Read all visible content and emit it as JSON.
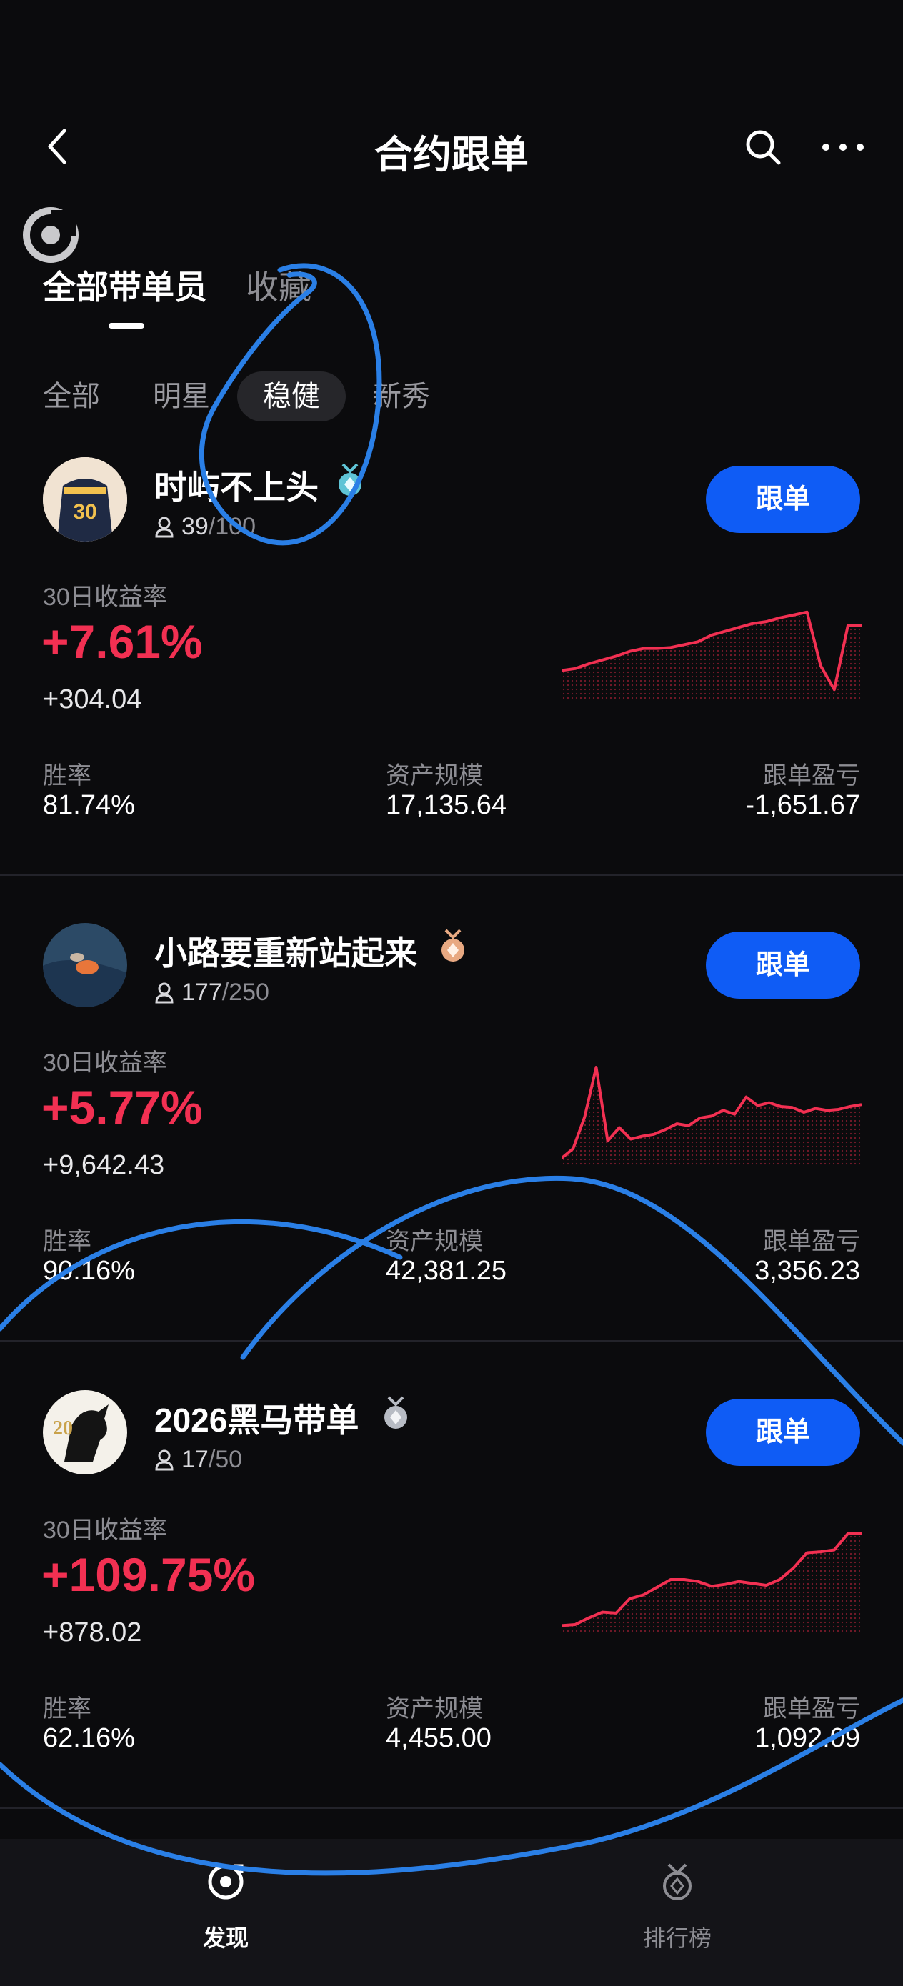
{
  "header": {
    "title": "合约跟单"
  },
  "tabs": [
    {
      "label": "全部带单员"
    },
    {
      "label": "收藏"
    }
  ],
  "filters": [
    {
      "label": "全部"
    },
    {
      "label": "明星"
    },
    {
      "label": "稳健"
    },
    {
      "label": "新秀"
    }
  ],
  "traders": [
    {
      "name": "时屿不上头",
      "followers": "39",
      "followers_total": "/100",
      "follow_label": "跟单",
      "return_label": "30日收益率",
      "return_pct": "+7.61%",
      "return_abs": "+304.04",
      "win_rate_label": "胜率",
      "win_rate": "81.74%",
      "aum_label": "资产规模",
      "aum": "17,135.64",
      "pnl_label": "跟单盈亏",
      "pnl": "-1,651.67",
      "badge_color": "#5fc4d6",
      "trend": [
        0.25,
        0.27,
        0.32,
        0.36,
        0.4,
        0.45,
        0.48,
        0.48,
        0.49,
        0.52,
        0.55,
        0.62,
        0.66,
        0.7,
        0.74,
        0.76,
        0.8,
        0.83,
        0.86,
        0.3,
        0.05,
        0.72,
        0.72
      ]
    },
    {
      "name": "小路要重新站起来",
      "followers": "177",
      "followers_total": "/250",
      "follow_label": "跟单",
      "return_label": "30日收益率",
      "return_pct": "+5.77%",
      "return_abs": "+9,642.43",
      "win_rate_label": "胜率",
      "win_rate": "90.16%",
      "aum_label": "资产规模",
      "aum": "42,381.25",
      "pnl_label": "跟单盈亏",
      "pnl": "3,356.23",
      "badge_color": "#e8a982",
      "trend": [
        0.02,
        0.12,
        0.45,
        0.97,
        0.2,
        0.34,
        0.22,
        0.25,
        0.27,
        0.32,
        0.38,
        0.36,
        0.44,
        0.46,
        0.52,
        0.48,
        0.66,
        0.57,
        0.6,
        0.56,
        0.55,
        0.5,
        0.54,
        0.52,
        0.53,
        0.56,
        0.58
      ]
    },
    {
      "name": "2026黑马带单",
      "followers": "17",
      "followers_total": "/50",
      "follow_label": "跟单",
      "return_label": "30日收益率",
      "return_pct": "+109.75%",
      "return_abs": "+878.02",
      "win_rate_label": "胜率",
      "win_rate": "62.16%",
      "aum_label": "资产规模",
      "aum": "4,455.00",
      "pnl_label": "跟单盈亏",
      "pnl": "1,092.09",
      "badge_color": "#b8bcc4",
      "trend": [
        0.02,
        0.03,
        0.1,
        0.16,
        0.15,
        0.3,
        0.34,
        0.42,
        0.5,
        0.5,
        0.48,
        0.43,
        0.45,
        0.48,
        0.46,
        0.44,
        0.5,
        0.62,
        0.78,
        0.79,
        0.81,
        0.98,
        0.98
      ]
    }
  ],
  "bottom_nav": [
    {
      "label": "发现",
      "active": true
    },
    {
      "label": "排行榜",
      "active": false
    }
  ],
  "colors": {
    "accent_blue": "#0f5cf5",
    "positive_red": "#f23052",
    "background": "#0b0b0d"
  }
}
